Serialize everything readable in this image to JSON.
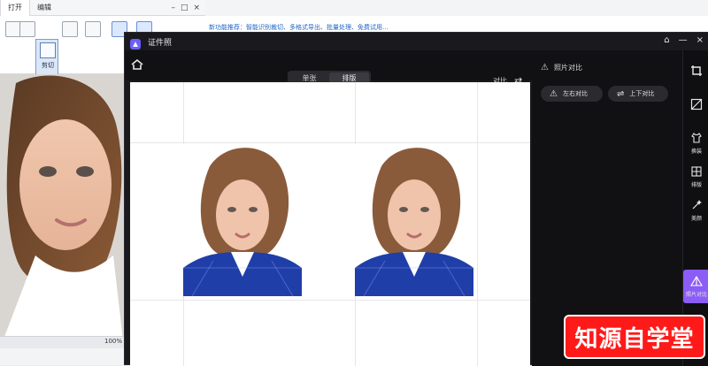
{
  "bg_editor": {
    "tabs": [
      "打开",
      "编辑"
    ],
    "selected_tool": "剪切",
    "blue_text": "新功能推荐：智能识别裁切、多格式导出、批量处理、免费试用…",
    "zoom": "100%"
  },
  "app": {
    "title": "证件照",
    "toolbar": {
      "segments": [
        "单张",
        "排版"
      ],
      "active_segment": 1,
      "compare_label": "对比"
    },
    "right_panel": {
      "title": "照片对比",
      "pill_left": "左右对比",
      "pill_right": "上下对比"
    },
    "sidebar": [
      {
        "icon": "crop-icon",
        "label": ""
      },
      {
        "icon": "background-icon",
        "label": ""
      },
      {
        "icon": "clothes-icon",
        "label": "换装"
      },
      {
        "icon": "layout-grid-icon",
        "label": "排版"
      },
      {
        "icon": "magic-icon",
        "label": "美颜"
      },
      {
        "icon": "compare-icon",
        "label": "照片对比",
        "active": true
      }
    ],
    "colors": {
      "accent": "#8b5cf6",
      "bg": "#1a1a1e",
      "panel": "#111114",
      "watermark_red": "#ff1a1a"
    }
  },
  "watermark": {
    "text": "知源自学堂"
  }
}
